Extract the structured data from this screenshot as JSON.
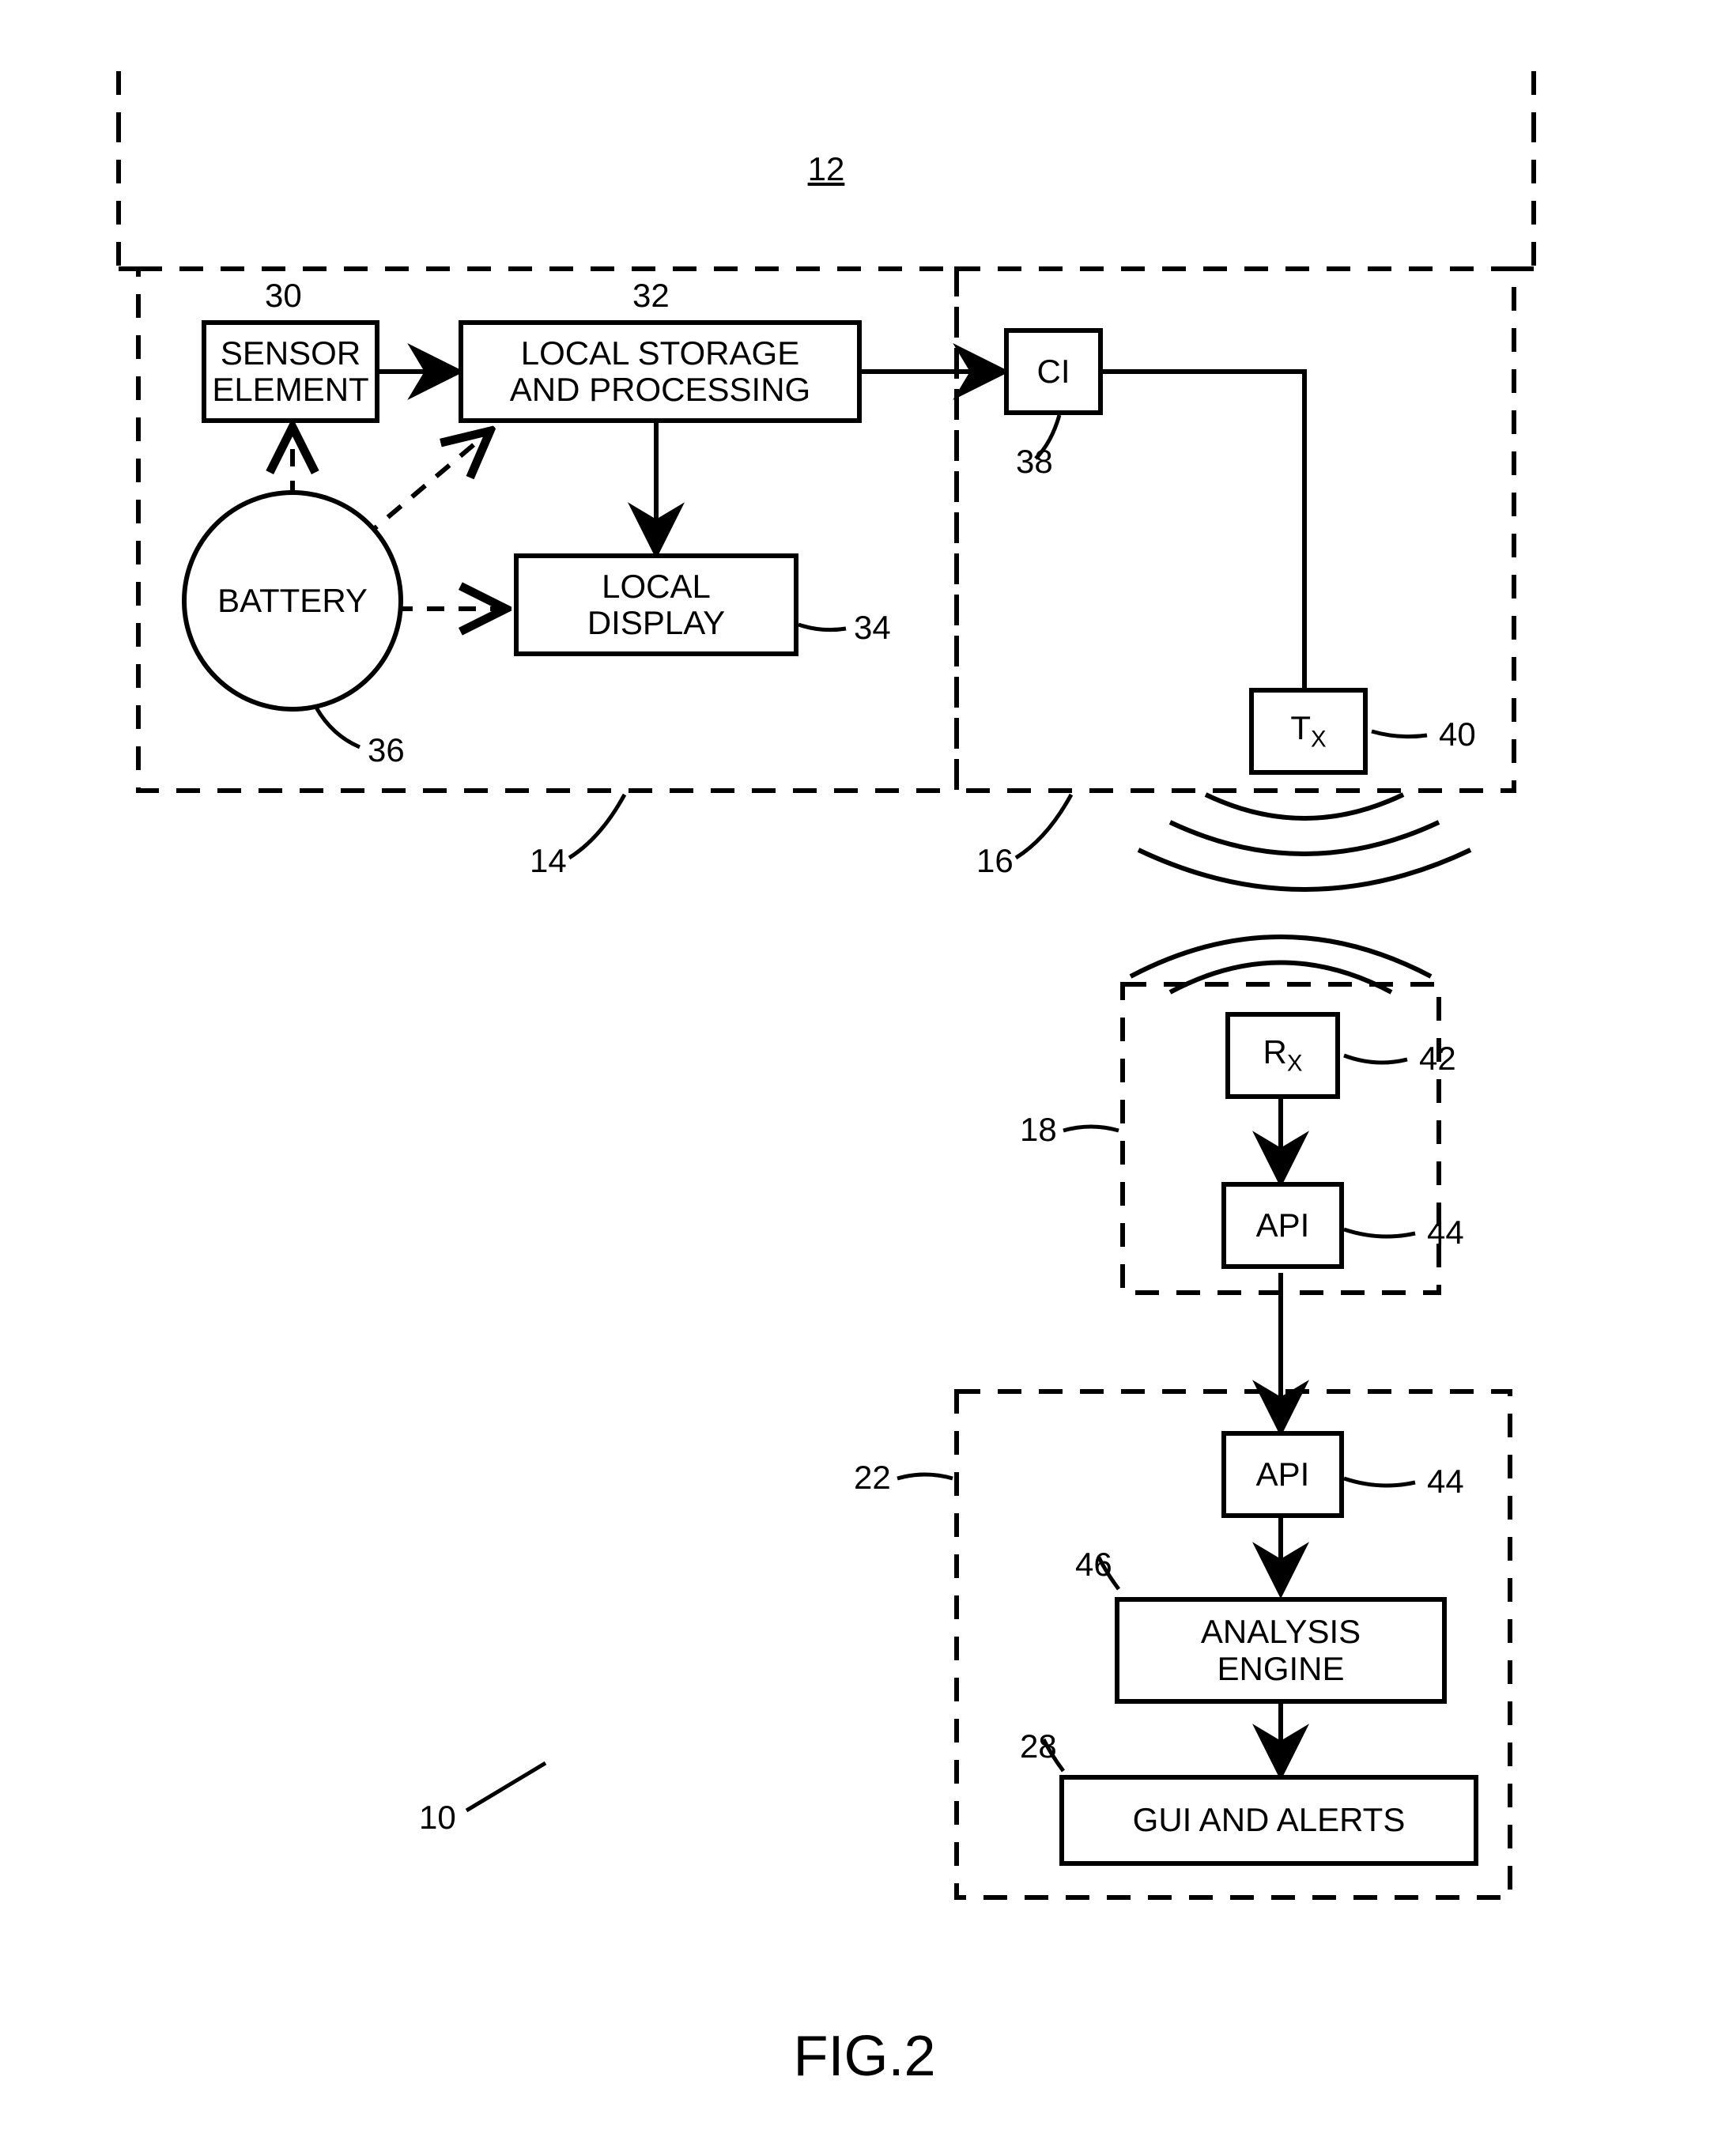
{
  "figure_caption": "FIG.2",
  "ref": {
    "overall": "10",
    "top_group": "12",
    "sensor_group": "14",
    "ci_group": "16",
    "rx_group": "18",
    "analysis_group": "22",
    "gui_num": "28",
    "sensor": "30",
    "storage": "32",
    "display": "34",
    "battery": "36",
    "ci": "38",
    "tx": "40",
    "rx": "42",
    "api1": "44",
    "api2": "44",
    "engine": "46"
  },
  "blocks": {
    "sensor": "SENSOR\nELEMENT",
    "storage": "LOCAL STORAGE\nAND PROCESSING",
    "display": "LOCAL\nDISPLAY",
    "battery": "BATTERY",
    "ci": "CI",
    "tx_pre": "T",
    "tx_sub": "X",
    "rx_pre": "R",
    "rx_sub": "X",
    "api": "API",
    "engine": "ANALYSIS\nENGINE",
    "gui": "GUI AND ALERTS"
  }
}
